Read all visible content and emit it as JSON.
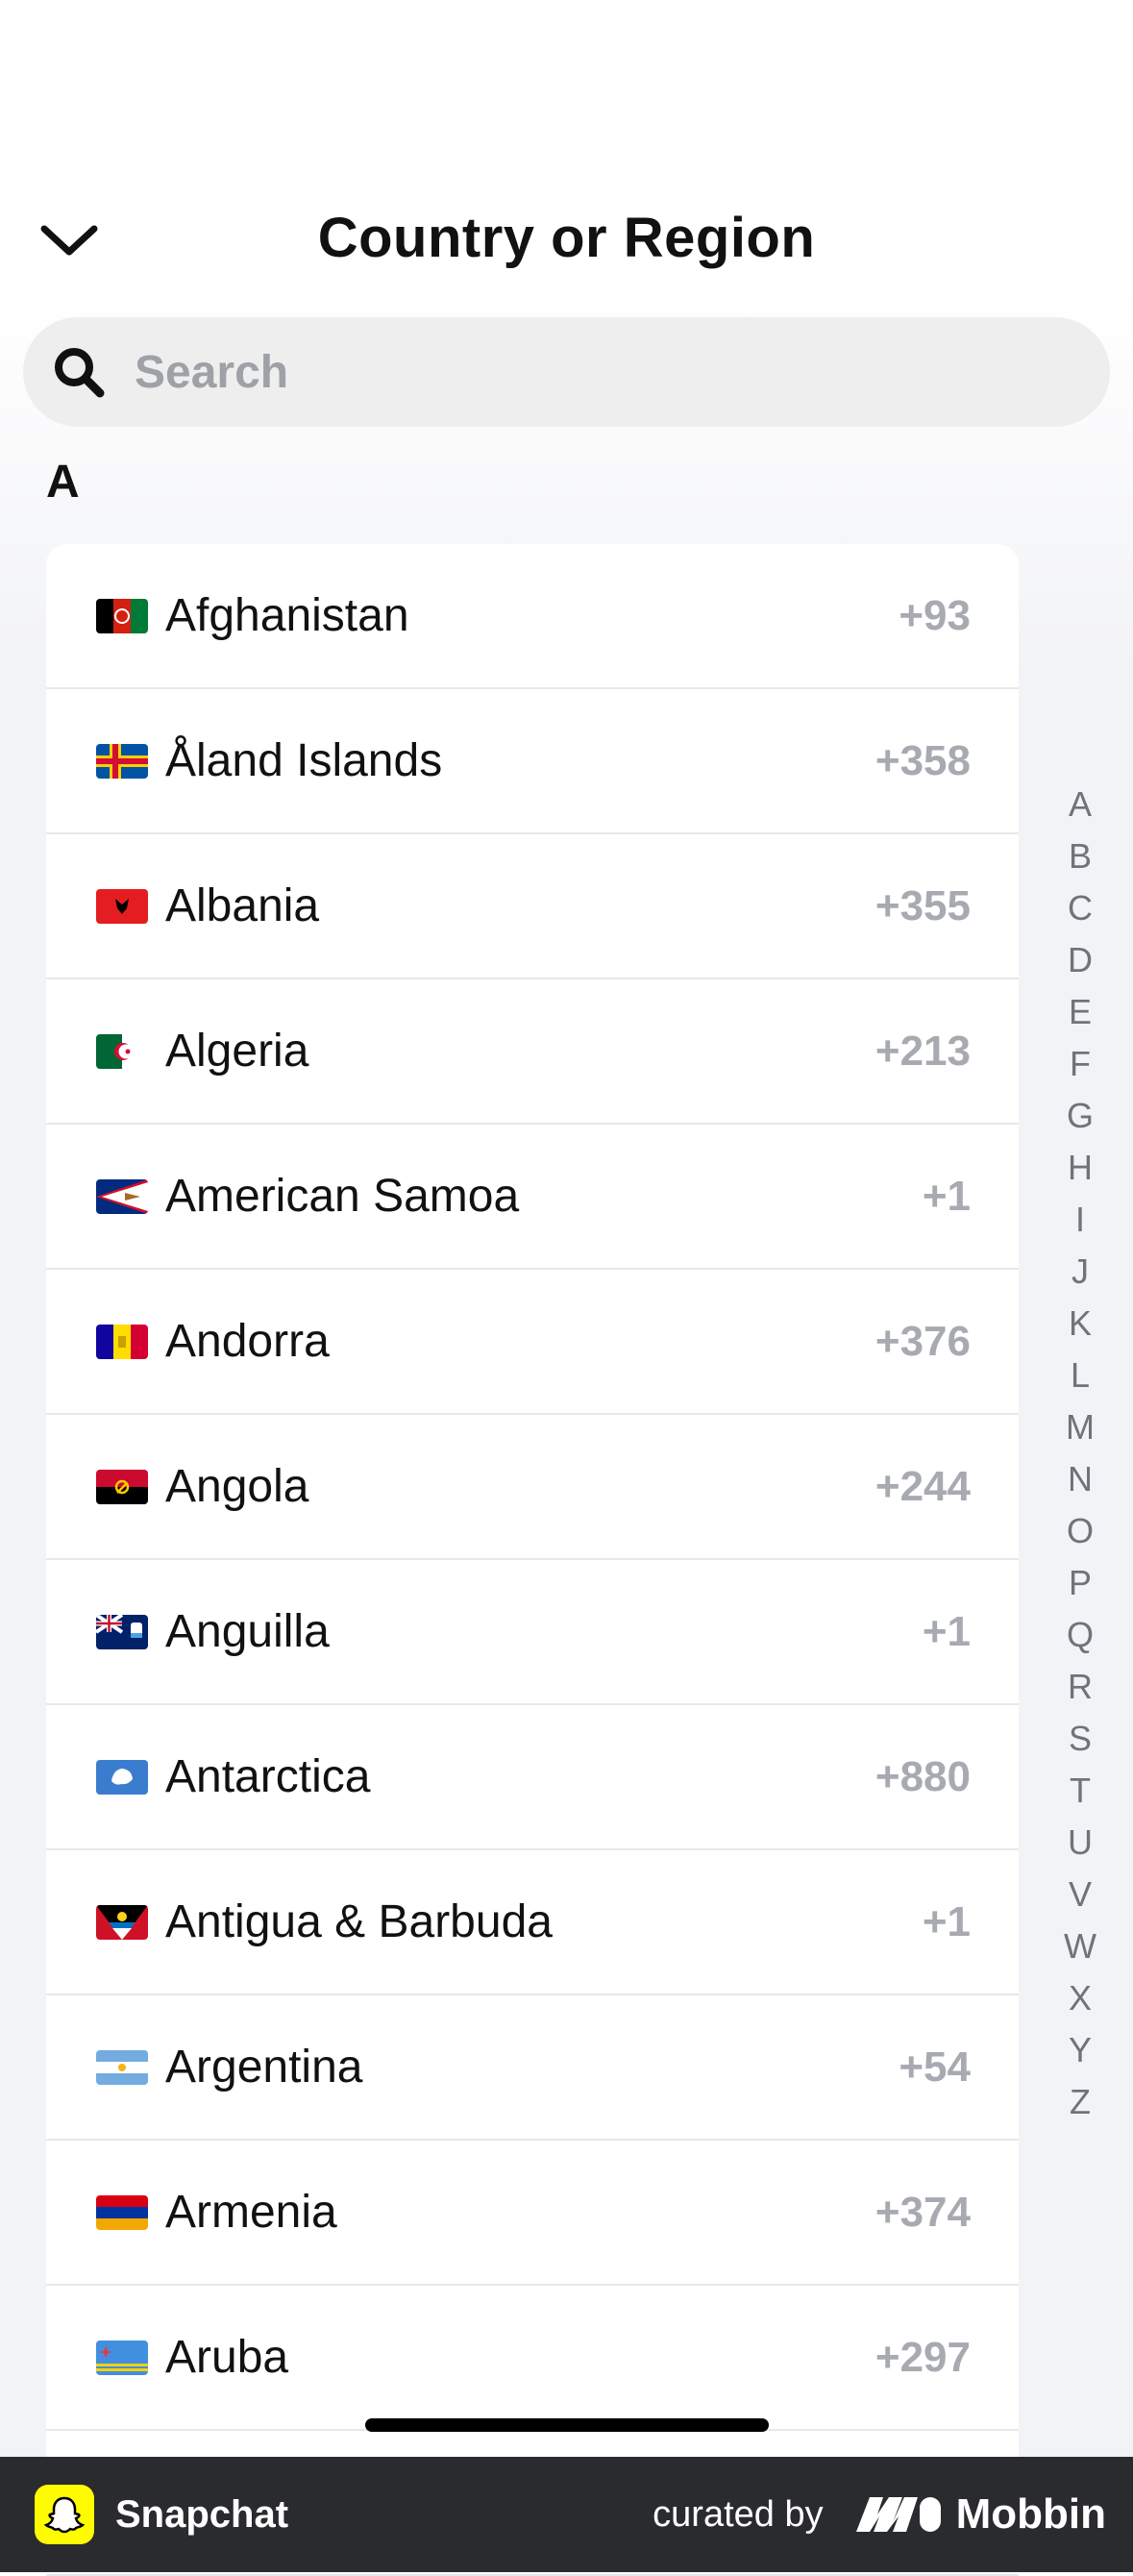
{
  "header": {
    "title": "Country or Region"
  },
  "search": {
    "placeholder": "Search"
  },
  "section": {
    "letter": "A"
  },
  "countries": [
    {
      "name": "Afghanistan",
      "code": "+93"
    },
    {
      "name": "Åland Islands",
      "code": "+358"
    },
    {
      "name": "Albania",
      "code": "+355"
    },
    {
      "name": "Algeria",
      "code": "+213"
    },
    {
      "name": "American Samoa",
      "code": "+1"
    },
    {
      "name": "Andorra",
      "code": "+376"
    },
    {
      "name": "Angola",
      "code": "+244"
    },
    {
      "name": "Anguilla",
      "code": "+1"
    },
    {
      "name": "Antarctica",
      "code": "+880"
    },
    {
      "name": "Antigua & Barbuda",
      "code": "+1"
    },
    {
      "name": "Argentina",
      "code": "+54"
    },
    {
      "name": "Armenia",
      "code": "+374"
    },
    {
      "name": "Aruba",
      "code": "+297"
    }
  ],
  "index_letters": [
    "A",
    "B",
    "C",
    "D",
    "E",
    "F",
    "G",
    "H",
    "I",
    "J",
    "K",
    "L",
    "M",
    "N",
    "O",
    "P",
    "Q",
    "R",
    "S",
    "T",
    "U",
    "V",
    "W",
    "X",
    "Y",
    "Z"
  ],
  "footer": {
    "app_name": "Snapchat",
    "curated_by": "curated by",
    "brand": "Mobbin"
  },
  "icons": {
    "back": "chevron-down-icon",
    "search": "search-icon",
    "snapchat": "snapchat-ghost-icon",
    "mobbin": "mobbin-logo-icon"
  },
  "colors": {
    "search_bg": "#eeeeef",
    "code_text": "#a7aab0",
    "index_text": "#6f737a",
    "footer_bg": "#2a2b2e",
    "snapchat_yellow": "#fffc00"
  }
}
